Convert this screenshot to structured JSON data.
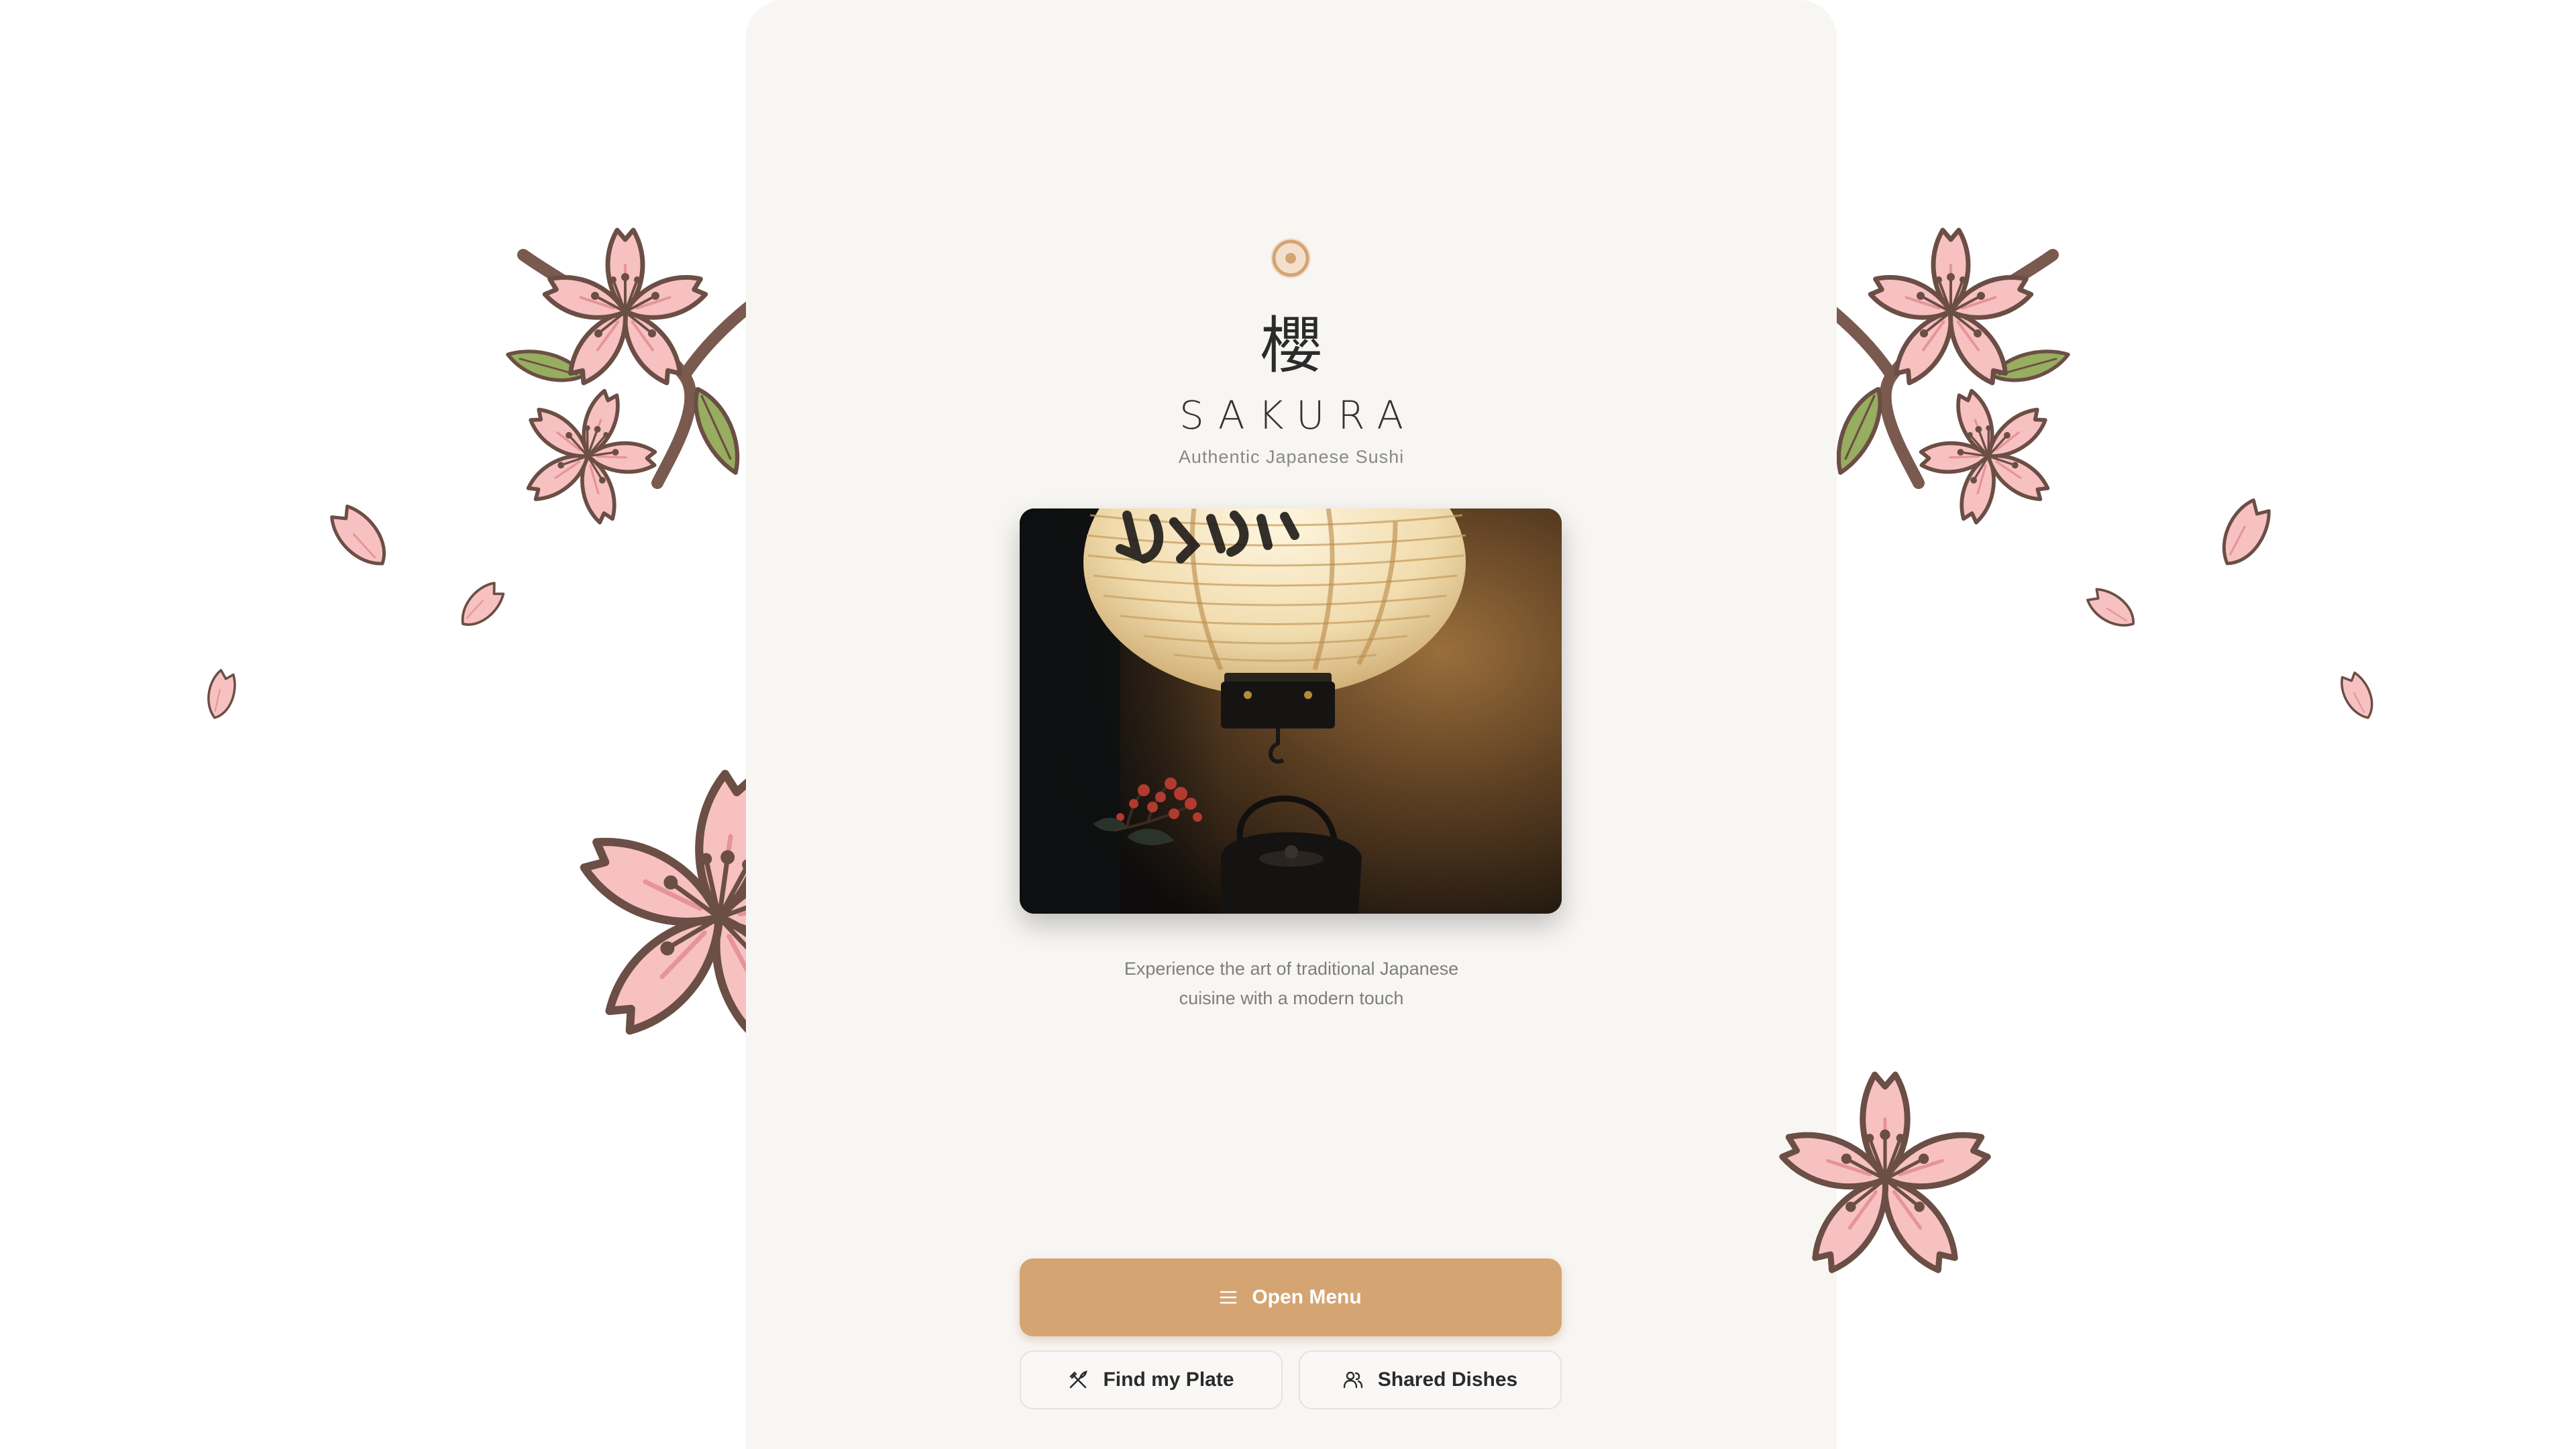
{
  "restaurant": {
    "kanji": "櫻",
    "name": "SAKURA",
    "tagline": "Authentic Japanese Sushi",
    "description_line1": "Experience the art of traditional Japanese",
    "description_line2": "cuisine with a modern touch"
  },
  "hero": {
    "image_subject": "paper lantern with teapot and red berries"
  },
  "actions": {
    "primary": {
      "label": "Open Menu",
      "icon": "menu-lines-icon"
    },
    "find_plate": {
      "label": "Find my Plate",
      "icon": "utensils-crossed-icon"
    },
    "shared_dishes": {
      "label": "Shared Dishes",
      "icon": "users-icon"
    }
  },
  "colors": {
    "accent": "#d4a473",
    "card_background": "#f8f6f3",
    "petal": "#f7c1c1",
    "petal_outline": "#6b4e45",
    "leaf": "#97ad5f"
  }
}
